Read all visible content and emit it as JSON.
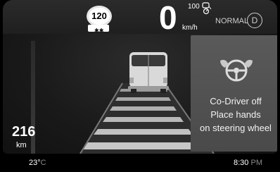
{
  "speed_limit": {
    "value": "120"
  },
  "speedometer": {
    "value": "0",
    "unit": "km/h"
  },
  "cruise": {
    "set_speed": "100"
  },
  "drive_mode": {
    "label": "NORMAL",
    "gear": "D"
  },
  "alert": {
    "line1": "Co-Driver off",
    "line2": "Place hands",
    "line3": "on steering wheel",
    "icon": "hands-on-steering-wheel-icon"
  },
  "range": {
    "value": "216",
    "unit": "km"
  },
  "status_bar": {
    "temperature": "23°",
    "temperature_unit": "C",
    "time": "8:30",
    "ampm": "PM"
  },
  "colors": {
    "panel": "#4f4f4f",
    "road": "#3a3a3a",
    "lane": "#bdbdbd",
    "text": "#ffffff"
  }
}
